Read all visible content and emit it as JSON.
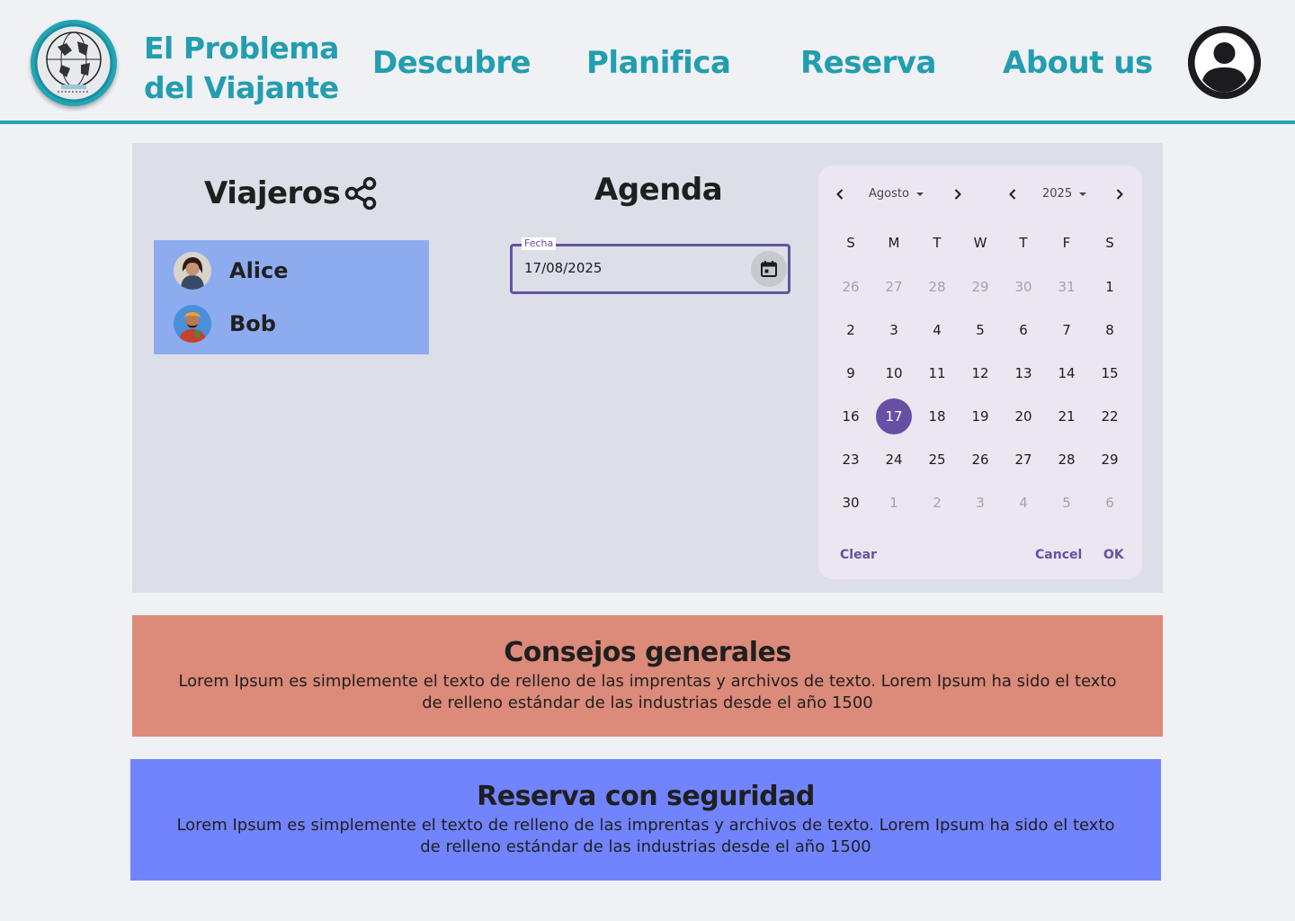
{
  "brand": {
    "line1": "El Problema",
    "line2": "del Viajante"
  },
  "nav": {
    "descubre": "Descubre",
    "planifica": "Planifica",
    "reserva": "Reserva",
    "about": "About us"
  },
  "colors": {
    "accent": "#23a3b8",
    "picker_primary": "#6750a4",
    "card1": "#dc8a79",
    "card2": "#7184fd",
    "travelers_bg": "#8dabef"
  },
  "icons": {
    "share": "share-icon",
    "calendar": "calendar-icon",
    "account": "account-circle-icon"
  },
  "viajeros": {
    "title": "Viajeros",
    "travelers": [
      {
        "name": "Alice"
      },
      {
        "name": "Bob"
      }
    ]
  },
  "agenda": {
    "title": "Agenda",
    "field_label": "Fecha",
    "field_value": "17/08/2025"
  },
  "picker": {
    "month": "Agosto",
    "year": "2025",
    "weekdays": [
      "S",
      "M",
      "T",
      "W",
      "T",
      "F",
      "S"
    ],
    "weeks": [
      [
        "26",
        "27",
        "28",
        "29",
        "30",
        "31",
        "1"
      ],
      [
        "2",
        "3",
        "4",
        "5",
        "6",
        "7",
        "8"
      ],
      [
        "9",
        "10",
        "11",
        "12",
        "13",
        "14",
        "15"
      ],
      [
        "16",
        "17",
        "18",
        "19",
        "20",
        "21",
        "22"
      ],
      [
        "23",
        "24",
        "25",
        "26",
        "27",
        "28",
        "29"
      ],
      [
        "30",
        "1",
        "2",
        "3",
        "4",
        "5",
        "6"
      ]
    ],
    "selected": "17",
    "clear": "Clear",
    "cancel": "Cancel",
    "ok": "OK"
  },
  "cards": [
    {
      "title": "Consejos generales",
      "text": "Lorem Ipsum es simplemente el texto de relleno de las imprentas y archivos de texto. Lorem Ipsum ha sido el texto de relleno estándar de las industrias desde el año 1500"
    },
    {
      "title": "Reserva con seguridad",
      "text": "Lorem Ipsum es simplemente el texto de relleno de las imprentas y archivos de texto. Lorem Ipsum ha sido el texto de relleno estándar de las industrias desde el año 1500"
    }
  ]
}
